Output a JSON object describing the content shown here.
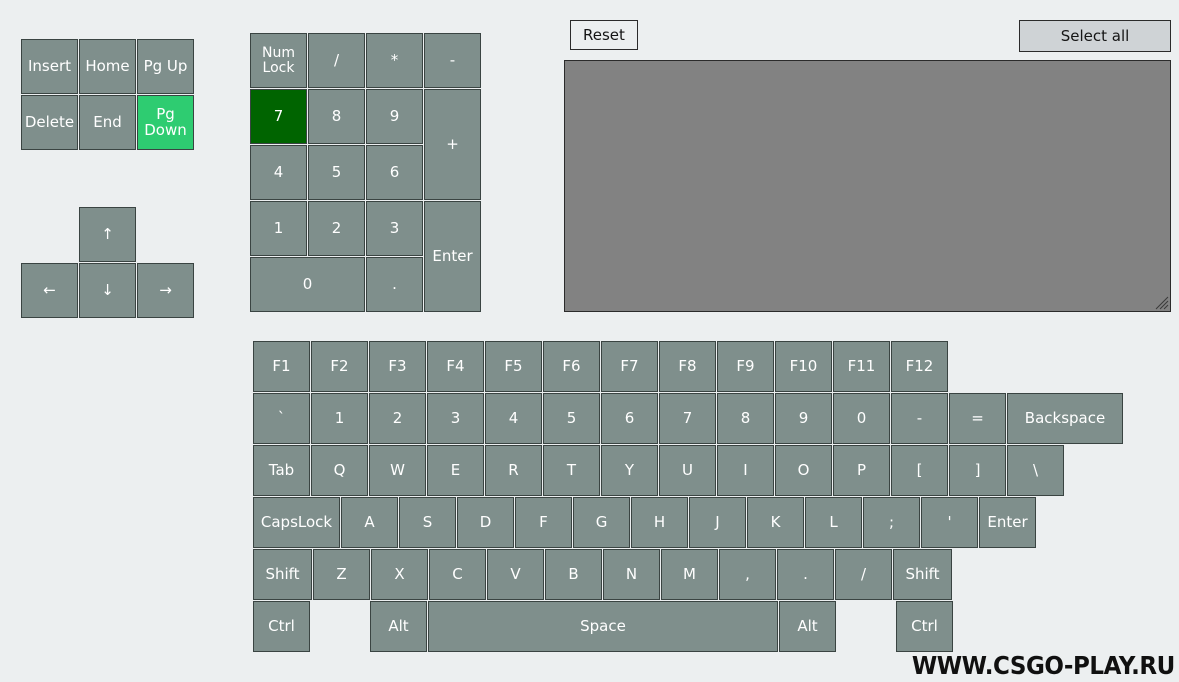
{
  "panel": {
    "reset_label": "Reset",
    "select_all_label": "Select all",
    "output_value": "",
    "output_placeholder": ""
  },
  "colors": {
    "background": "#eceff0",
    "key_fill": "#7f8f8c",
    "key_border": "#3a4442",
    "key_text": "#ffffff",
    "selected_bright": "#2ecc71",
    "selected_dark": "#006400",
    "button_fill": "#cfd3d6",
    "output_fill": "#828282"
  },
  "nav_cluster": {
    "rows": [
      [
        {
          "label": "Insert",
          "state": "normal"
        },
        {
          "label": "Home",
          "state": "normal"
        },
        {
          "label": "Pg Up",
          "state": "normal"
        }
      ],
      [
        {
          "label": "Delete",
          "state": "normal"
        },
        {
          "label": "End",
          "state": "normal"
        },
        {
          "label": "Pg\nDown",
          "state": "selected-bright"
        }
      ]
    ]
  },
  "arrow_cluster": {
    "rows": [
      [
        {
          "label": "",
          "state": "spacer"
        },
        {
          "label": "↑",
          "state": "normal",
          "name": "arrow-up"
        },
        {
          "label": "",
          "state": "spacer"
        }
      ],
      [
        {
          "label": "←",
          "state": "normal",
          "name": "arrow-left"
        },
        {
          "label": "↓",
          "state": "normal",
          "name": "arrow-down"
        },
        {
          "label": "→",
          "state": "normal",
          "name": "arrow-right"
        }
      ]
    ]
  },
  "numpad": {
    "keys": {
      "numlock": "Num\nLock",
      "divide": "/",
      "multiply": "*",
      "subtract": "-",
      "n7": "7",
      "n8": "8",
      "n9": "9",
      "add": "+",
      "n4": "4",
      "n5": "5",
      "n6": "6",
      "n1": "1",
      "n2": "2",
      "n3": "3",
      "enter": "Enter",
      "n0": "0",
      "dot": "."
    },
    "selected": [
      "n7"
    ]
  },
  "main_keyboard": {
    "rows": [
      {
        "name": "function-row",
        "keys": [
          {
            "label": "F1"
          },
          {
            "label": "F2"
          },
          {
            "label": "F3"
          },
          {
            "label": "F4"
          },
          {
            "label": "F5"
          },
          {
            "label": "F6"
          },
          {
            "label": "F7"
          },
          {
            "label": "F8"
          },
          {
            "label": "F9"
          },
          {
            "label": "F10"
          },
          {
            "label": "F11"
          },
          {
            "label": "F12"
          }
        ]
      },
      {
        "name": "number-row",
        "keys": [
          {
            "label": "`"
          },
          {
            "label": "1"
          },
          {
            "label": "2"
          },
          {
            "label": "3"
          },
          {
            "label": "4"
          },
          {
            "label": "5"
          },
          {
            "label": "6"
          },
          {
            "label": "7"
          },
          {
            "label": "8"
          },
          {
            "label": "9"
          },
          {
            "label": "0"
          },
          {
            "label": "-"
          },
          {
            "label": "="
          },
          {
            "label": "Backspace",
            "width": "backspace"
          }
        ]
      },
      {
        "name": "tab-row",
        "keys": [
          {
            "label": "Tab"
          },
          {
            "label": "Q"
          },
          {
            "label": "W"
          },
          {
            "label": "E"
          },
          {
            "label": "R"
          },
          {
            "label": "T"
          },
          {
            "label": "Y"
          },
          {
            "label": "U"
          },
          {
            "label": "I"
          },
          {
            "label": "O"
          },
          {
            "label": "P"
          },
          {
            "label": "["
          },
          {
            "label": "]"
          },
          {
            "label": "\\"
          }
        ]
      },
      {
        "name": "home-row",
        "keys": [
          {
            "label": "CapsLock",
            "width": "caps"
          },
          {
            "label": "A"
          },
          {
            "label": "S"
          },
          {
            "label": "D"
          },
          {
            "label": "F"
          },
          {
            "label": "G"
          },
          {
            "label": "H"
          },
          {
            "label": "J"
          },
          {
            "label": "K"
          },
          {
            "label": "L"
          },
          {
            "label": ";"
          },
          {
            "label": "'"
          },
          {
            "label": "Enter",
            "width": "enter"
          }
        ]
      },
      {
        "name": "shift-row",
        "keys": [
          {
            "label": "Shift",
            "width": "shift"
          },
          {
            "label": "Z"
          },
          {
            "label": "X"
          },
          {
            "label": "C"
          },
          {
            "label": "V"
          },
          {
            "label": "B"
          },
          {
            "label": "N"
          },
          {
            "label": "M"
          },
          {
            "label": ","
          },
          {
            "label": "."
          },
          {
            "label": "/"
          },
          {
            "label": "Shift",
            "width": "shift"
          }
        ]
      },
      {
        "name": "bottom-row",
        "keys": [
          {
            "label": "Ctrl"
          },
          {
            "label": "",
            "spacer": true
          },
          {
            "label": "Alt"
          },
          {
            "label": "Space",
            "width": "space"
          },
          {
            "label": "Alt"
          },
          {
            "label": "",
            "spacer": true
          },
          {
            "label": "Ctrl"
          }
        ]
      }
    ]
  },
  "watermark": {
    "text": "WWW.CSGO-PLAY.RU"
  }
}
